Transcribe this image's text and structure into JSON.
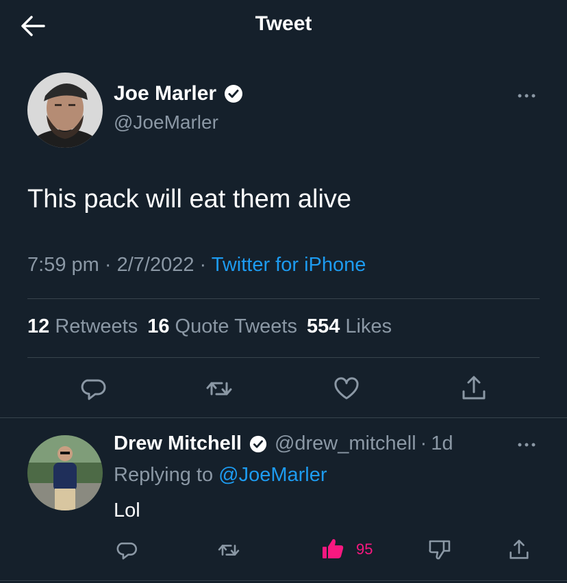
{
  "header": {
    "title": "Tweet",
    "back_icon": "arrow-left-icon"
  },
  "tweet": {
    "author_name": "Joe Marler",
    "author_handle": "@JoeMarler",
    "text": "This pack will eat them alive",
    "time": "7:59 pm",
    "date": "2/7/2022",
    "separator": " · ",
    "source": "Twitter for iPhone",
    "stats": {
      "retweets_count": "12",
      "retweets_label": "Retweets",
      "quotes_count": "16",
      "quotes_label": "Quote Tweets",
      "likes_count": "554",
      "likes_label": "Likes"
    }
  },
  "reply": {
    "author_name": "Drew Mitchell",
    "author_handle": "@drew_mitchell",
    "separator": "·",
    "age": "1d",
    "replying_prefix": "Replying to",
    "replying_to": "@JoeMarler",
    "text": "Lol",
    "like_count": "95"
  },
  "colors": {
    "background": "#15202b",
    "accent": "#1d9bf0",
    "muted": "#8b98a5",
    "like": "#f91880",
    "divider": "#38444d"
  }
}
